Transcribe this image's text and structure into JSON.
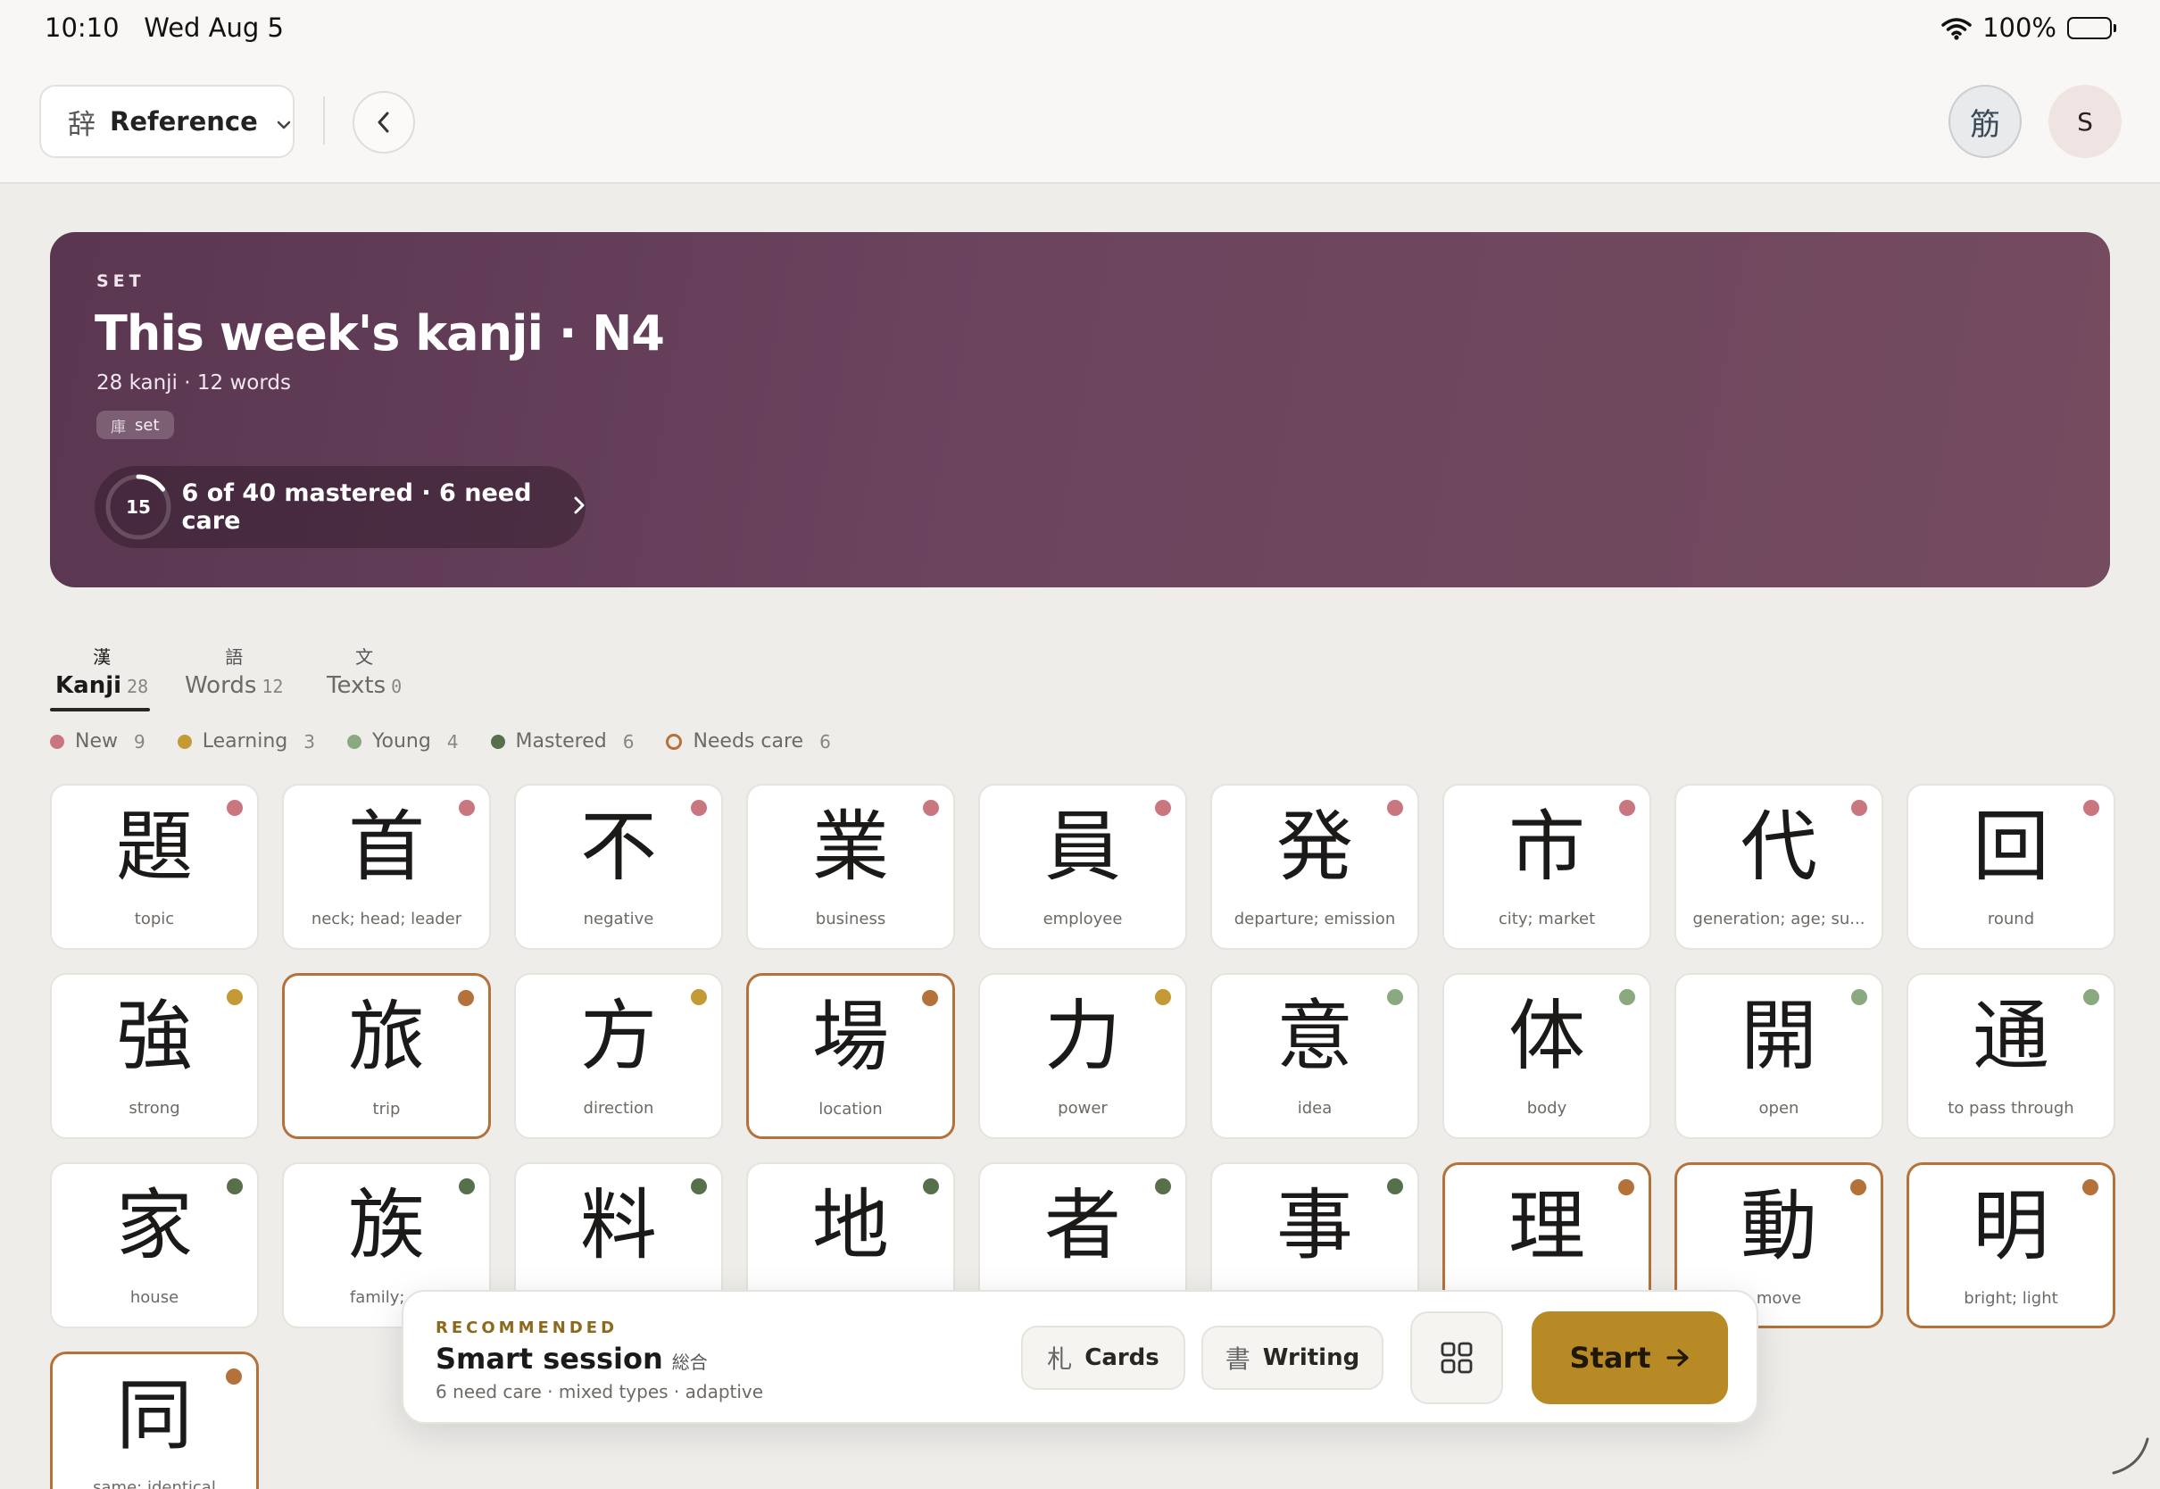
{
  "status": {
    "time": "10:10",
    "date": "Wed Aug 5",
    "battery": "100%"
  },
  "header": {
    "mode_glyph": "辞",
    "mode_label": "Reference",
    "kanji_avatar": "筋",
    "user_initial": "S"
  },
  "hero": {
    "eyebrow": "SET",
    "title": "This week's kanji · N4",
    "meta": "28 kanji · 12 words",
    "badge_glyph": "庫",
    "badge_label": "set",
    "progress_count": "15",
    "progress_fraction": 0.15,
    "progress_text": "6 of 40 mastered · 6 need care"
  },
  "tabs": [
    {
      "glyph": "漢",
      "label": "Kanji",
      "count": "28",
      "active": true
    },
    {
      "glyph": "語",
      "label": "Words",
      "count": "12",
      "active": false
    },
    {
      "glyph": "文",
      "label": "Texts",
      "count": "0",
      "active": false
    }
  ],
  "legend": [
    {
      "label": "New",
      "count": "9",
      "color": "#c9767e",
      "ring": false
    },
    {
      "label": "Learning",
      "count": "3",
      "color": "#c49a35",
      "ring": false
    },
    {
      "label": "Young",
      "count": "4",
      "color": "#8aa981",
      "ring": false
    },
    {
      "label": "Mastered",
      "count": "6",
      "color": "#56704c",
      "ring": false
    },
    {
      "label": "Needs care",
      "count": "6",
      "color": "#b5713a",
      "ring": true
    }
  ],
  "status_colors": {
    "new": "#c9767e",
    "learning": "#c49a35",
    "young": "#8aa981",
    "mastered": "#56704c",
    "care": "#b5713a"
  },
  "kanji": [
    {
      "char": "題",
      "meaning": "topic",
      "status": "new"
    },
    {
      "char": "首",
      "meaning": "neck; head; leader",
      "status": "new"
    },
    {
      "char": "不",
      "meaning": "negative",
      "status": "new"
    },
    {
      "char": "業",
      "meaning": "business",
      "status": "new"
    },
    {
      "char": "員",
      "meaning": "employee",
      "status": "new"
    },
    {
      "char": "発",
      "meaning": "departure; emission",
      "status": "new"
    },
    {
      "char": "市",
      "meaning": "city; market",
      "status": "new"
    },
    {
      "char": "代",
      "meaning": "generation; age; su...",
      "status": "new"
    },
    {
      "char": "回",
      "meaning": "round",
      "status": "new"
    },
    {
      "char": "強",
      "meaning": "strong",
      "status": "learning"
    },
    {
      "char": "旅",
      "meaning": "trip",
      "status": "care"
    },
    {
      "char": "方",
      "meaning": "direction",
      "status": "learning"
    },
    {
      "char": "場",
      "meaning": "location",
      "status": "care"
    },
    {
      "char": "力",
      "meaning": "power",
      "status": "learning"
    },
    {
      "char": "意",
      "meaning": "idea",
      "status": "young"
    },
    {
      "char": "体",
      "meaning": "body",
      "status": "young"
    },
    {
      "char": "開",
      "meaning": "open",
      "status": "young"
    },
    {
      "char": "通",
      "meaning": "to pass through",
      "status": "young"
    },
    {
      "char": "家",
      "meaning": "house",
      "status": "mastered"
    },
    {
      "char": "族",
      "meaning": "family; cl",
      "status": "mastered"
    },
    {
      "char": "料",
      "meaning": "",
      "status": "mastered"
    },
    {
      "char": "地",
      "meaning": "",
      "status": "mastered"
    },
    {
      "char": "者",
      "meaning": "",
      "status": "mastered"
    },
    {
      "char": "事",
      "meaning": "",
      "status": "mastered"
    },
    {
      "char": "理",
      "meaning": "",
      "status": "care"
    },
    {
      "char": "動",
      "meaning": "move",
      "status": "care"
    },
    {
      "char": "明",
      "meaning": "bright; light",
      "status": "care"
    },
    {
      "char": "同",
      "meaning": "same; identical",
      "status": "care"
    }
  ],
  "session": {
    "eyebrow": "RECOMMENDED",
    "title": "Smart session",
    "title_glyph": "総合",
    "meta": "6 need care · mixed types · adaptive",
    "cards_glyph": "札",
    "cards_label": "Cards",
    "writing_glyph": "書",
    "writing_label": "Writing",
    "start_label": "Start"
  }
}
